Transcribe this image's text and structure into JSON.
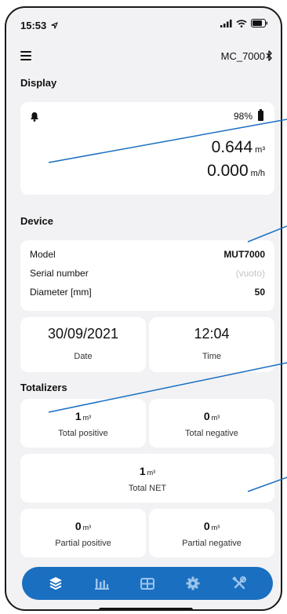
{
  "status_bar": {
    "time": "15:53"
  },
  "header": {
    "device_name": "MC_7000"
  },
  "display": {
    "title": "Display",
    "battery": "98%",
    "volume": {
      "value": "0.644",
      "unit": "m³"
    },
    "flow": {
      "value": "0.000",
      "unit": "m/h"
    }
  },
  "device": {
    "title": "Device",
    "rows": [
      {
        "label": "Model",
        "value": "MUT7000"
      },
      {
        "label": "Serial number",
        "value": "(vuoto)"
      },
      {
        "label": "Diameter [mm]",
        "value": "50"
      }
    ],
    "date": {
      "value": "30/09/2021",
      "label": "Date"
    },
    "time": {
      "value": "12:04",
      "label": "Time"
    }
  },
  "totalizers": {
    "title": "Totalizers",
    "total_positive": {
      "value": "1",
      "unit": "m³",
      "label": "Total positive"
    },
    "total_negative": {
      "value": "0",
      "unit": "m³",
      "label": "Total negative"
    },
    "total_net": {
      "value": "1",
      "unit": "m³",
      "label": "Total NET"
    },
    "partial_positive": {
      "value": "0",
      "unit": "m³",
      "label": "Partial positive"
    },
    "partial_negative": {
      "value": "0",
      "unit": "m³",
      "label": "Partial negative"
    }
  },
  "nav": {
    "items": [
      "layers-icon",
      "bar-chart-icon",
      "table-icon",
      "settings-icon",
      "tools-icon"
    ]
  },
  "colors": {
    "accent": "#1a6fc0",
    "background": "#f2f2f4",
    "card": "#ffffff"
  }
}
